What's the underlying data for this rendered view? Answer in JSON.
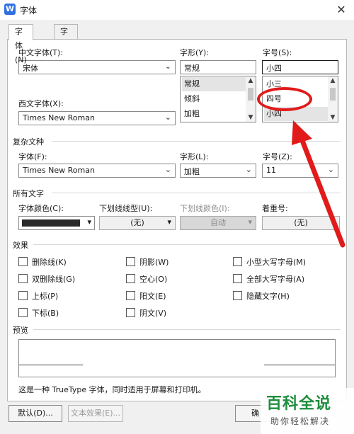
{
  "window": {
    "title": "字体",
    "icon": "W"
  },
  "tabs": [
    {
      "label": "字体(N)"
    },
    {
      "label": "字符间距(R)"
    }
  ],
  "font": {
    "chinese_label": "中文字体(T):",
    "chinese_value": "宋体",
    "style_label": "字形(Y):",
    "style_value": "常规",
    "style_list": [
      "常规",
      "倾斜",
      "加粗"
    ],
    "size_label": "字号(S):",
    "size_value": "小四",
    "size_list": [
      "小三",
      "四号",
      "小四"
    ],
    "western_label": "西文字体(X):",
    "western_value": "Times New Roman"
  },
  "complex": {
    "section": "复杂文种",
    "font_label": "字体(F):",
    "font_value": "Times New Roman",
    "style_label": "字形(L):",
    "style_value": "加粗",
    "size_label": "字号(Z):",
    "size_value": "11"
  },
  "all_text": {
    "section": "所有文字",
    "color_label": "字体颜色(C):",
    "color_value": "#2a2a2a",
    "underline_label": "下划线线型(U):",
    "underline_value": "(无)",
    "underline_color_label": "下划线颜色(I):",
    "underline_color_value": "自动",
    "emphasis_label": "着重号:",
    "emphasis_value": "(无)"
  },
  "effects": {
    "section": "效果",
    "items": [
      "删除线(K)",
      "双删除线(G)",
      "上标(P)",
      "下标(B)",
      "阴影(W)",
      "空心(O)",
      "阳文(E)",
      "阴文(V)",
      "小型大写字母(M)",
      "全部大写字母(A)",
      "隐藏文字(H)"
    ]
  },
  "preview": {
    "section": "预览",
    "note": "这是一种 TrueType 字体，同时适用于屏幕和打印机。"
  },
  "buttons": {
    "default": "默认(D)...",
    "text_effect": "文本效果(E)...",
    "ok": "确"
  },
  "icons": {
    "close": "✕",
    "dropdown": "⌄",
    "scroll_up": "▲",
    "scroll_down": "▼",
    "combo_arrow": "▾"
  },
  "annotation": {
    "color": "#e11a1a"
  },
  "watermark": {
    "brand": "百科全说",
    "tagline": "助你轻松解决"
  }
}
